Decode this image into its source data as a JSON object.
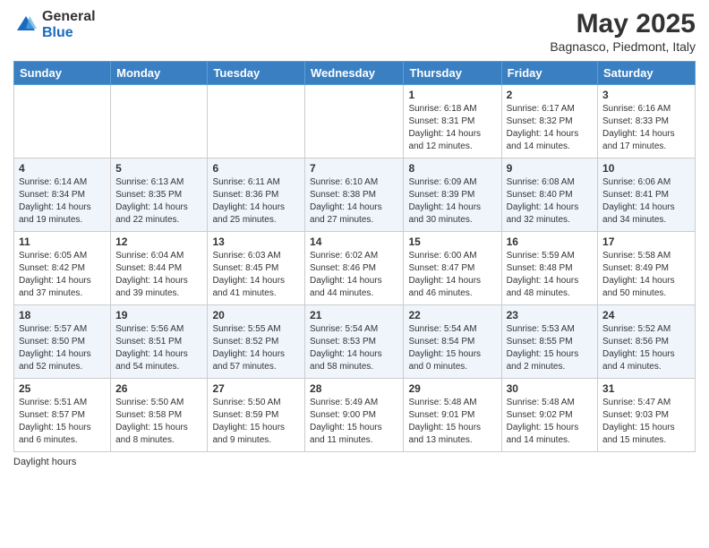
{
  "header": {
    "logo_general": "General",
    "logo_blue": "Blue",
    "month_title": "May 2025",
    "location": "Bagnasco, Piedmont, Italy"
  },
  "weekdays": [
    "Sunday",
    "Monday",
    "Tuesday",
    "Wednesday",
    "Thursday",
    "Friday",
    "Saturday"
  ],
  "footer": {
    "daylight_note": "Daylight hours"
  },
  "weeks": [
    [
      {
        "day": "",
        "info": ""
      },
      {
        "day": "",
        "info": ""
      },
      {
        "day": "",
        "info": ""
      },
      {
        "day": "",
        "info": ""
      },
      {
        "day": "1",
        "info": "Sunrise: 6:18 AM\nSunset: 8:31 PM\nDaylight: 14 hours\nand 12 minutes."
      },
      {
        "day": "2",
        "info": "Sunrise: 6:17 AM\nSunset: 8:32 PM\nDaylight: 14 hours\nand 14 minutes."
      },
      {
        "day": "3",
        "info": "Sunrise: 6:16 AM\nSunset: 8:33 PM\nDaylight: 14 hours\nand 17 minutes."
      }
    ],
    [
      {
        "day": "4",
        "info": "Sunrise: 6:14 AM\nSunset: 8:34 PM\nDaylight: 14 hours\nand 19 minutes."
      },
      {
        "day": "5",
        "info": "Sunrise: 6:13 AM\nSunset: 8:35 PM\nDaylight: 14 hours\nand 22 minutes."
      },
      {
        "day": "6",
        "info": "Sunrise: 6:11 AM\nSunset: 8:36 PM\nDaylight: 14 hours\nand 25 minutes."
      },
      {
        "day": "7",
        "info": "Sunrise: 6:10 AM\nSunset: 8:38 PM\nDaylight: 14 hours\nand 27 minutes."
      },
      {
        "day": "8",
        "info": "Sunrise: 6:09 AM\nSunset: 8:39 PM\nDaylight: 14 hours\nand 30 minutes."
      },
      {
        "day": "9",
        "info": "Sunrise: 6:08 AM\nSunset: 8:40 PM\nDaylight: 14 hours\nand 32 minutes."
      },
      {
        "day": "10",
        "info": "Sunrise: 6:06 AM\nSunset: 8:41 PM\nDaylight: 14 hours\nand 34 minutes."
      }
    ],
    [
      {
        "day": "11",
        "info": "Sunrise: 6:05 AM\nSunset: 8:42 PM\nDaylight: 14 hours\nand 37 minutes."
      },
      {
        "day": "12",
        "info": "Sunrise: 6:04 AM\nSunset: 8:44 PM\nDaylight: 14 hours\nand 39 minutes."
      },
      {
        "day": "13",
        "info": "Sunrise: 6:03 AM\nSunset: 8:45 PM\nDaylight: 14 hours\nand 41 minutes."
      },
      {
        "day": "14",
        "info": "Sunrise: 6:02 AM\nSunset: 8:46 PM\nDaylight: 14 hours\nand 44 minutes."
      },
      {
        "day": "15",
        "info": "Sunrise: 6:00 AM\nSunset: 8:47 PM\nDaylight: 14 hours\nand 46 minutes."
      },
      {
        "day": "16",
        "info": "Sunrise: 5:59 AM\nSunset: 8:48 PM\nDaylight: 14 hours\nand 48 minutes."
      },
      {
        "day": "17",
        "info": "Sunrise: 5:58 AM\nSunset: 8:49 PM\nDaylight: 14 hours\nand 50 minutes."
      }
    ],
    [
      {
        "day": "18",
        "info": "Sunrise: 5:57 AM\nSunset: 8:50 PM\nDaylight: 14 hours\nand 52 minutes."
      },
      {
        "day": "19",
        "info": "Sunrise: 5:56 AM\nSunset: 8:51 PM\nDaylight: 14 hours\nand 54 minutes."
      },
      {
        "day": "20",
        "info": "Sunrise: 5:55 AM\nSunset: 8:52 PM\nDaylight: 14 hours\nand 57 minutes."
      },
      {
        "day": "21",
        "info": "Sunrise: 5:54 AM\nSunset: 8:53 PM\nDaylight: 14 hours\nand 58 minutes."
      },
      {
        "day": "22",
        "info": "Sunrise: 5:54 AM\nSunset: 8:54 PM\nDaylight: 15 hours\nand 0 minutes."
      },
      {
        "day": "23",
        "info": "Sunrise: 5:53 AM\nSunset: 8:55 PM\nDaylight: 15 hours\nand 2 minutes."
      },
      {
        "day": "24",
        "info": "Sunrise: 5:52 AM\nSunset: 8:56 PM\nDaylight: 15 hours\nand 4 minutes."
      }
    ],
    [
      {
        "day": "25",
        "info": "Sunrise: 5:51 AM\nSunset: 8:57 PM\nDaylight: 15 hours\nand 6 minutes."
      },
      {
        "day": "26",
        "info": "Sunrise: 5:50 AM\nSunset: 8:58 PM\nDaylight: 15 hours\nand 8 minutes."
      },
      {
        "day": "27",
        "info": "Sunrise: 5:50 AM\nSunset: 8:59 PM\nDaylight: 15 hours\nand 9 minutes."
      },
      {
        "day": "28",
        "info": "Sunrise: 5:49 AM\nSunset: 9:00 PM\nDaylight: 15 hours\nand 11 minutes."
      },
      {
        "day": "29",
        "info": "Sunrise: 5:48 AM\nSunset: 9:01 PM\nDaylight: 15 hours\nand 13 minutes."
      },
      {
        "day": "30",
        "info": "Sunrise: 5:48 AM\nSunset: 9:02 PM\nDaylight: 15 hours\nand 14 minutes."
      },
      {
        "day": "31",
        "info": "Sunrise: 5:47 AM\nSunset: 9:03 PM\nDaylight: 15 hours\nand 15 minutes."
      }
    ]
  ]
}
